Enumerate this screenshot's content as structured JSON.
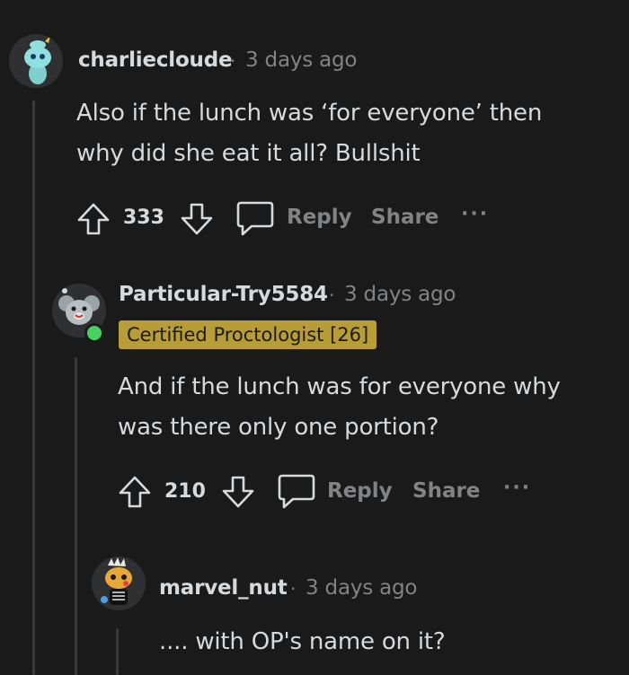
{
  "comments": [
    {
      "username": "charliecloude",
      "separator": "·",
      "time": "3 days ago",
      "body_line1": "Also if the lunch was ‘for everyone’ then",
      "body_line2": "why did she eat it all? Bullshit",
      "score": "333",
      "reply_label": "Reply",
      "share_label": "Share",
      "more_label": "···"
    },
    {
      "username": "Particular-Try5584",
      "separator": "·",
      "time": "3 days ago",
      "flair": "Certified Proctologist [26]",
      "body_line1": "And if the lunch was for everyone why",
      "body_line2": "was there only one portion?",
      "score": "210",
      "reply_label": "Reply",
      "share_label": "Share",
      "more_label": "···"
    },
    {
      "username": "marvel_nut",
      "separator": "·",
      "time": "3 days ago",
      "body_line1": ".... with OP's name on it?"
    }
  ],
  "colors": {
    "background": "#1a1a1b",
    "text": "#d7dadc",
    "muted": "#818384",
    "flair_bg": "#b89c37",
    "online": "#46d160"
  }
}
